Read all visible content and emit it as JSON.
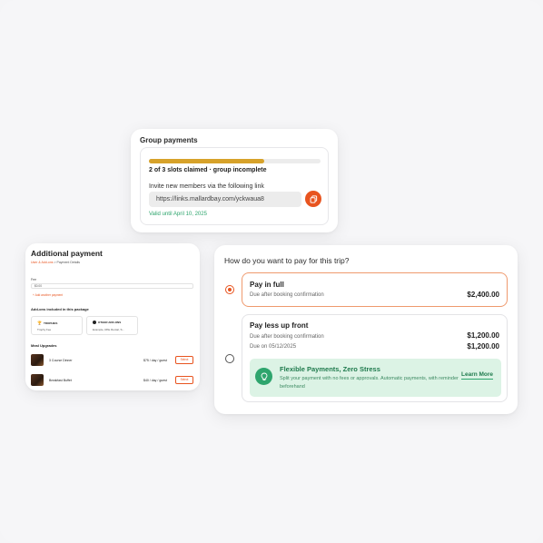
{
  "group_payments": {
    "title": "Group payments",
    "progress_fraction": 0.67,
    "slots_text": "2 of 3 slots claimed · group incomplete",
    "invite_text": "Invite new members via the following link",
    "link": "https://links.mallardbay.com/yckwaua8",
    "valid_text": "Valid until April 10, 2025",
    "copy_icon": "copy-icon"
  },
  "additional_payment": {
    "title": "Additional payment",
    "breadcrumb": {
      "step1": "User & Add-ons",
      "separator": ">",
      "step2": "Payment Details"
    },
    "field_label": "Fee",
    "field_value": "$0.00",
    "add_link": "+ Add another payment",
    "addons_heading": "Add-ons included in this package",
    "addons": [
      {
        "title": "TROPHIES",
        "subtitle": "Trophy Fee",
        "icon": "trophy-icon"
      },
      {
        "title": "OTHER ADD-ONS",
        "subtitle": "Example, Rifle Rental, S...",
        "icon": "info-icon"
      }
    ],
    "upgrades_heading": "Meal Upgrades",
    "upgrades": [
      {
        "name": "3 Course Dinner",
        "price": "$75 / day / guest",
        "button": "Select"
      },
      {
        "name": "Breakfast Buffet",
        "price": "$40 / day / guest",
        "button": "Select"
      }
    ]
  },
  "pay": {
    "question": "How do you want to pay for this trip?",
    "full": {
      "title": "Pay in full",
      "subtitle": "Due after booking confirmation",
      "amount": "$2,400.00",
      "selected": true
    },
    "less": {
      "title": "Pay less up front",
      "line1_label": "Due after booking confirmation",
      "line1_amount": "$1,200.00",
      "line2_label": "Due on 05/12/2025",
      "line2_amount": "$1,200.00",
      "selected": false
    },
    "flexible": {
      "title": "Flexible Payments, Zero Stress",
      "description": "Split your payment with no fees or approvals. Automatic payments, with reminder beforehand",
      "link": "Learn More",
      "icon": "lightbulb-icon"
    }
  },
  "colors": {
    "accent": "#e8541f",
    "progress": "#d7a22a",
    "success": "#2ea56d",
    "success_bg": "#dcf3e5"
  }
}
